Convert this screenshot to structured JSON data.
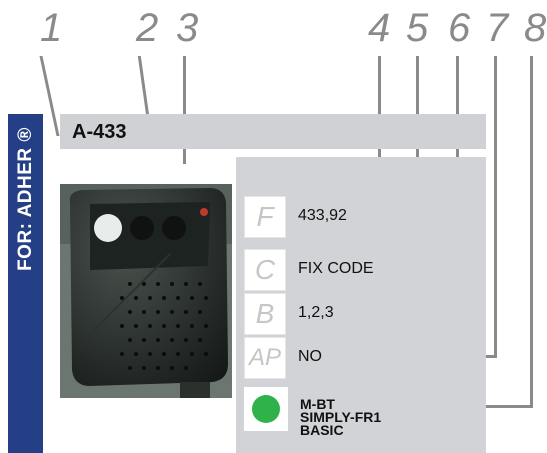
{
  "callouts": [
    "1",
    "2",
    "3",
    "4",
    "5",
    "6",
    "7",
    "8"
  ],
  "sidebar": {
    "text": "FOR: ADHER ®"
  },
  "header": {
    "model": "A-433"
  },
  "params": [
    {
      "key": "F",
      "value": "433,92"
    },
    {
      "key": "C",
      "value": "FIX CODE"
    },
    {
      "key": "B",
      "value": "1,2,3"
    },
    {
      "key": "AP",
      "value": "NO"
    }
  ],
  "compatible": {
    "lines": [
      "M-BT",
      "SIMPLY-FR1",
      "BASIC"
    ],
    "color": "#2fb24a"
  },
  "colors": {
    "sidebar": "#243f85",
    "panel": "#d1d3d6",
    "callout": "#8a8a8a"
  }
}
